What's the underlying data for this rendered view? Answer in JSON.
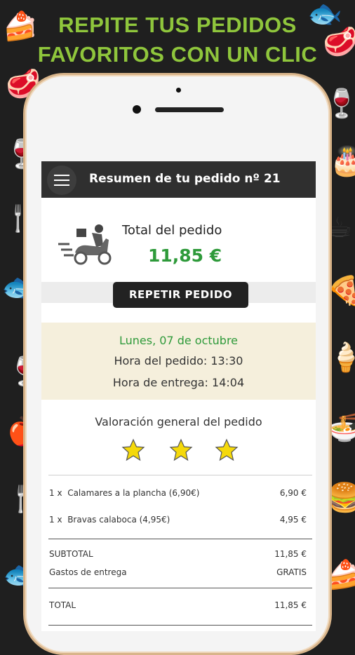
{
  "headline": {
    "line1": "REPITE TUS PEDIDOS",
    "line2": "FAVORITOS CON UN CLIC"
  },
  "appbar": {
    "title": "Resumen de tu pedido nº 21"
  },
  "order": {
    "total_label": "Total del pedido",
    "total_value": "11,85 €",
    "repeat_button": "REPETIR PEDIDO"
  },
  "date_box": {
    "date": "Lunes, 07 de octubre",
    "order_time": "Hora del pedido: 13:30",
    "delivery_time": "Hora de entrega: 14:04"
  },
  "rating": {
    "label": "Valoración general del pedido",
    "stars": 3,
    "star_color": "#f5d90a"
  },
  "items": [
    {
      "qty": "1 x",
      "name": "Calamares a la plancha (6,90€)",
      "price": "6,90 €"
    },
    {
      "qty": "1 x",
      "name": "Bravas calaboca (4,95€)",
      "price": "4,95 €"
    }
  ],
  "summary": {
    "subtotal_label": "SUBTOTAL",
    "subtotal_value": "11,85 €",
    "delivery_label": "Gastos de entrega",
    "delivery_value": "GRATIS",
    "total_label": "TOTAL",
    "total_value": "11,85 €"
  },
  "colors": {
    "accent_green": "#8fc63c",
    "price_green": "#2e9a3a",
    "date_green": "#2e9a3a"
  }
}
